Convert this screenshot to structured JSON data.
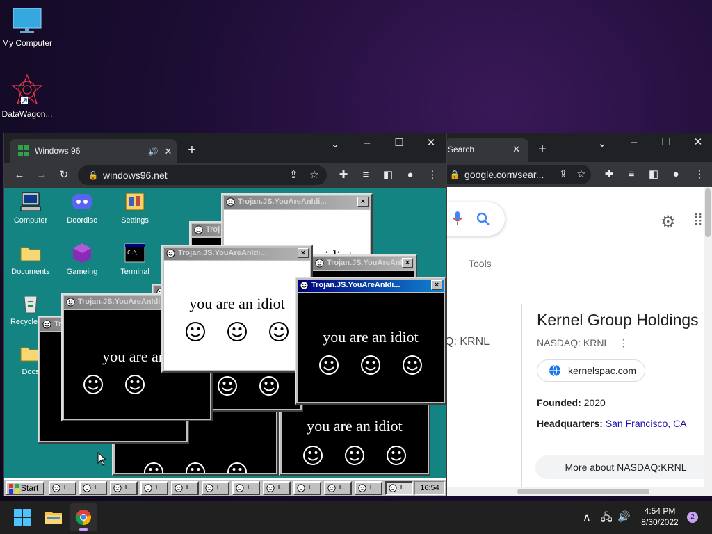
{
  "desktop": {
    "icons": [
      {
        "label": "My Computer",
        "icon": "monitor-icon"
      },
      {
        "label": "DataWagon...",
        "icon": "datawagon-icon"
      }
    ]
  },
  "chrome_google": {
    "tab_title": "Search",
    "url": "google.com/sear...",
    "tools_label": "Tools",
    "knowledge_panel": {
      "title": "Kernel Group Holdings",
      "ticker": "NASDAQ: KRNL",
      "ticker_left": "Q: KRNL",
      "website": "kernelspac.com",
      "founded_label": "Founded:",
      "founded_value": "2020",
      "hq_label": "Headquarters:",
      "hq_value": "San Francisco, CA",
      "more_button": "More about NASDAQ:KRNL"
    }
  },
  "chrome_w96": {
    "tab_title": "Windows 96",
    "url": "windows96.net"
  },
  "w96": {
    "icons": [
      {
        "label": "Computer"
      },
      {
        "label": "Doordisc"
      },
      {
        "label": "Settings"
      },
      {
        "label": "Documents"
      },
      {
        "label": "Gameing"
      },
      {
        "label": "Terminal"
      },
      {
        "label": "Recycle Bin"
      },
      {
        "label": "Docs"
      }
    ],
    "popup_title": "Trojan.JS.YouAreAnIdi...",
    "popup_title_short": "Trojan.JS.YouAreAnIdi",
    "popup_title_trunc": "Troj",
    "popup_message": "you are an idiot",
    "popup_message_cut": "you are an",
    "popup_message_top": "idiot",
    "taskbar": {
      "start": "Start",
      "task_label": "T..",
      "clock": "16:54"
    }
  },
  "taskbar": {
    "time": "4:54 PM",
    "date": "8/30/2022",
    "notifications": "2"
  },
  "colors": {
    "w96_desktop": "#138482",
    "w96_title_active": "#00007b",
    "chrome_dark": "#202124",
    "google_link": "#1a0dab"
  }
}
